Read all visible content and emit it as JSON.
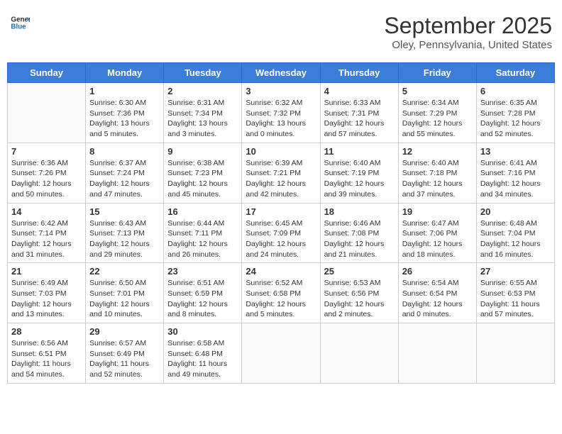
{
  "header": {
    "logo_line1": "General",
    "logo_line2": "Blue",
    "month": "September 2025",
    "location": "Oley, Pennsylvania, United States"
  },
  "days_of_week": [
    "Sunday",
    "Monday",
    "Tuesday",
    "Wednesday",
    "Thursday",
    "Friday",
    "Saturday"
  ],
  "weeks": [
    [
      {
        "day": "",
        "empty": true
      },
      {
        "day": "1",
        "sunrise": "Sunrise: 6:30 AM",
        "sunset": "Sunset: 7:36 PM",
        "daylight": "Daylight: 13 hours and 5 minutes."
      },
      {
        "day": "2",
        "sunrise": "Sunrise: 6:31 AM",
        "sunset": "Sunset: 7:34 PM",
        "daylight": "Daylight: 13 hours and 3 minutes."
      },
      {
        "day": "3",
        "sunrise": "Sunrise: 6:32 AM",
        "sunset": "Sunset: 7:32 PM",
        "daylight": "Daylight: 13 hours and 0 minutes."
      },
      {
        "day": "4",
        "sunrise": "Sunrise: 6:33 AM",
        "sunset": "Sunset: 7:31 PM",
        "daylight": "Daylight: 12 hours and 57 minutes."
      },
      {
        "day": "5",
        "sunrise": "Sunrise: 6:34 AM",
        "sunset": "Sunset: 7:29 PM",
        "daylight": "Daylight: 12 hours and 55 minutes."
      },
      {
        "day": "6",
        "sunrise": "Sunrise: 6:35 AM",
        "sunset": "Sunset: 7:28 PM",
        "daylight": "Daylight: 12 hours and 52 minutes."
      }
    ],
    [
      {
        "day": "7",
        "sunrise": "Sunrise: 6:36 AM",
        "sunset": "Sunset: 7:26 PM",
        "daylight": "Daylight: 12 hours and 50 minutes."
      },
      {
        "day": "8",
        "sunrise": "Sunrise: 6:37 AM",
        "sunset": "Sunset: 7:24 PM",
        "daylight": "Daylight: 12 hours and 47 minutes."
      },
      {
        "day": "9",
        "sunrise": "Sunrise: 6:38 AM",
        "sunset": "Sunset: 7:23 PM",
        "daylight": "Daylight: 12 hours and 45 minutes."
      },
      {
        "day": "10",
        "sunrise": "Sunrise: 6:39 AM",
        "sunset": "Sunset: 7:21 PM",
        "daylight": "Daylight: 12 hours and 42 minutes."
      },
      {
        "day": "11",
        "sunrise": "Sunrise: 6:40 AM",
        "sunset": "Sunset: 7:19 PM",
        "daylight": "Daylight: 12 hours and 39 minutes."
      },
      {
        "day": "12",
        "sunrise": "Sunrise: 6:40 AM",
        "sunset": "Sunset: 7:18 PM",
        "daylight": "Daylight: 12 hours and 37 minutes."
      },
      {
        "day": "13",
        "sunrise": "Sunrise: 6:41 AM",
        "sunset": "Sunset: 7:16 PM",
        "daylight": "Daylight: 12 hours and 34 minutes."
      }
    ],
    [
      {
        "day": "14",
        "sunrise": "Sunrise: 6:42 AM",
        "sunset": "Sunset: 7:14 PM",
        "daylight": "Daylight: 12 hours and 31 minutes."
      },
      {
        "day": "15",
        "sunrise": "Sunrise: 6:43 AM",
        "sunset": "Sunset: 7:13 PM",
        "daylight": "Daylight: 12 hours and 29 minutes."
      },
      {
        "day": "16",
        "sunrise": "Sunrise: 6:44 AM",
        "sunset": "Sunset: 7:11 PM",
        "daylight": "Daylight: 12 hours and 26 minutes."
      },
      {
        "day": "17",
        "sunrise": "Sunrise: 6:45 AM",
        "sunset": "Sunset: 7:09 PM",
        "daylight": "Daylight: 12 hours and 24 minutes."
      },
      {
        "day": "18",
        "sunrise": "Sunrise: 6:46 AM",
        "sunset": "Sunset: 7:08 PM",
        "daylight": "Daylight: 12 hours and 21 minutes."
      },
      {
        "day": "19",
        "sunrise": "Sunrise: 6:47 AM",
        "sunset": "Sunset: 7:06 PM",
        "daylight": "Daylight: 12 hours and 18 minutes."
      },
      {
        "day": "20",
        "sunrise": "Sunrise: 6:48 AM",
        "sunset": "Sunset: 7:04 PM",
        "daylight": "Daylight: 12 hours and 16 minutes."
      }
    ],
    [
      {
        "day": "21",
        "sunrise": "Sunrise: 6:49 AM",
        "sunset": "Sunset: 7:03 PM",
        "daylight": "Daylight: 12 hours and 13 minutes."
      },
      {
        "day": "22",
        "sunrise": "Sunrise: 6:50 AM",
        "sunset": "Sunset: 7:01 PM",
        "daylight": "Daylight: 12 hours and 10 minutes."
      },
      {
        "day": "23",
        "sunrise": "Sunrise: 6:51 AM",
        "sunset": "Sunset: 6:59 PM",
        "daylight": "Daylight: 12 hours and 8 minutes."
      },
      {
        "day": "24",
        "sunrise": "Sunrise: 6:52 AM",
        "sunset": "Sunset: 6:58 PM",
        "daylight": "Daylight: 12 hours and 5 minutes."
      },
      {
        "day": "25",
        "sunrise": "Sunrise: 6:53 AM",
        "sunset": "Sunset: 6:56 PM",
        "daylight": "Daylight: 12 hours and 2 minutes."
      },
      {
        "day": "26",
        "sunrise": "Sunrise: 6:54 AM",
        "sunset": "Sunset: 6:54 PM",
        "daylight": "Daylight: 12 hours and 0 minutes."
      },
      {
        "day": "27",
        "sunrise": "Sunrise: 6:55 AM",
        "sunset": "Sunset: 6:53 PM",
        "daylight": "Daylight: 11 hours and 57 minutes."
      }
    ],
    [
      {
        "day": "28",
        "sunrise": "Sunrise: 6:56 AM",
        "sunset": "Sunset: 6:51 PM",
        "daylight": "Daylight: 11 hours and 54 minutes."
      },
      {
        "day": "29",
        "sunrise": "Sunrise: 6:57 AM",
        "sunset": "Sunset: 6:49 PM",
        "daylight": "Daylight: 11 hours and 52 minutes."
      },
      {
        "day": "30",
        "sunrise": "Sunrise: 6:58 AM",
        "sunset": "Sunset: 6:48 PM",
        "daylight": "Daylight: 11 hours and 49 minutes."
      },
      {
        "day": "",
        "empty": true
      },
      {
        "day": "",
        "empty": true
      },
      {
        "day": "",
        "empty": true
      },
      {
        "day": "",
        "empty": true
      }
    ]
  ]
}
